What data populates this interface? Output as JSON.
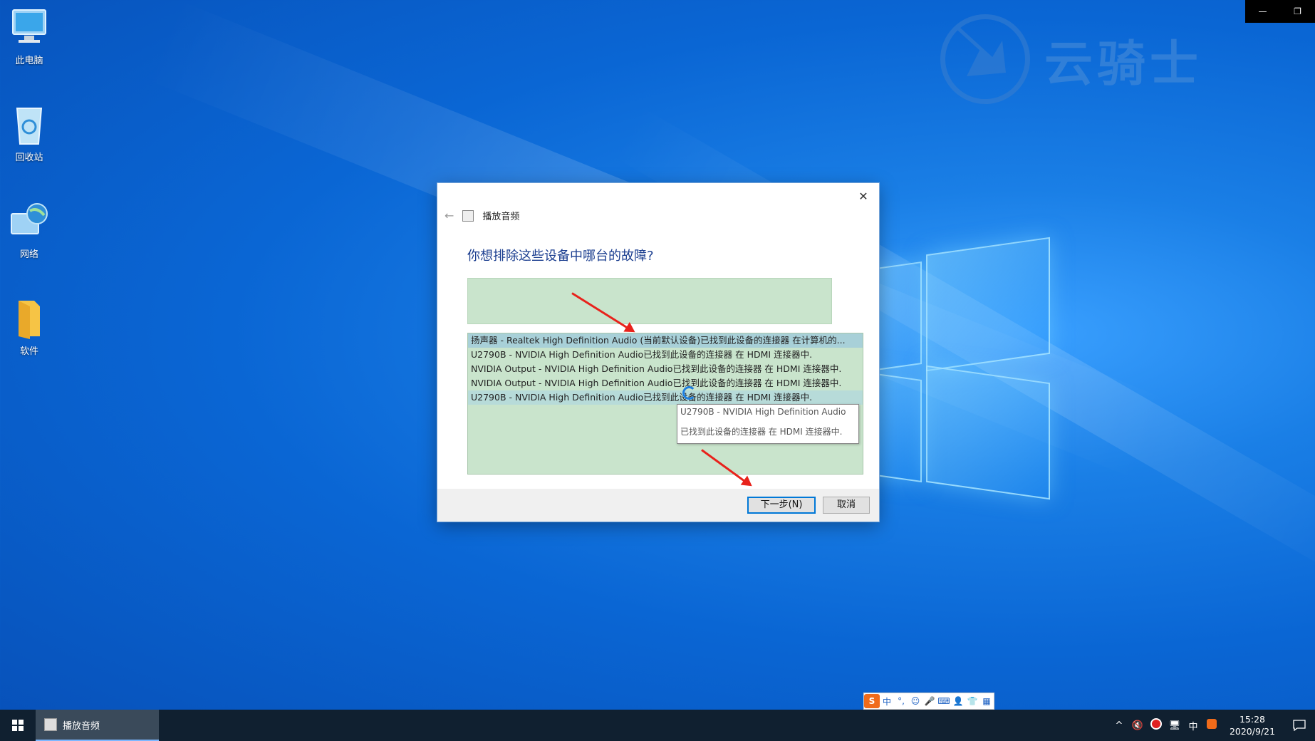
{
  "desktop": {
    "icons": [
      {
        "label": "此电脑",
        "icon": "computer-icon"
      },
      {
        "label": "回收站",
        "icon": "recycle-bin-icon"
      },
      {
        "label": "网络",
        "icon": "network-icon"
      },
      {
        "label": "软件",
        "icon": "folder-icon"
      }
    ],
    "watermark_text": "云骑士"
  },
  "window_controls": {
    "minimize": "—",
    "restore": "❐"
  },
  "dialog": {
    "close": "✕",
    "back": "←",
    "app_title": "播放音频",
    "heading": "你想排除这些设备中哪台的故障?",
    "devices": [
      "扬声器 - Realtek High Definition Audio (当前默认设备)已找到此设备的连接器 在计算机的...",
      "U2790B - NVIDIA High Definition Audio已找到此设备的连接器 在 HDMI 连接器中.",
      "NVIDIA Output - NVIDIA High Definition Audio已找到此设备的连接器 在 HDMI 连接器中.",
      "NVIDIA Output - NVIDIA High Definition Audio已找到此设备的连接器 在 HDMI 连接器中.",
      "U2790B - NVIDIA High Definition Audio已找到此设备的连接器 在 HDMI 连接器中."
    ],
    "tooltip": {
      "line1": "U2790B - NVIDIA High Definition Audio",
      "line2": "已找到此设备的连接器 在 HDMI 连接器中."
    },
    "next_button": "下一步(N)",
    "cancel_button": "取消"
  },
  "ime": {
    "logo": "S",
    "mode": "中",
    "punct": "°,"
  },
  "taskbar": {
    "active_app": "播放音频",
    "tray": {
      "chevron": "^",
      "volume": "🔇",
      "ime": "中"
    },
    "clock": {
      "time": "15:28",
      "date": "2020/9/21"
    }
  },
  "colors": {
    "accent": "#0078d7",
    "arrow": "#e8221b",
    "list_bg": "#c9e4cc"
  }
}
